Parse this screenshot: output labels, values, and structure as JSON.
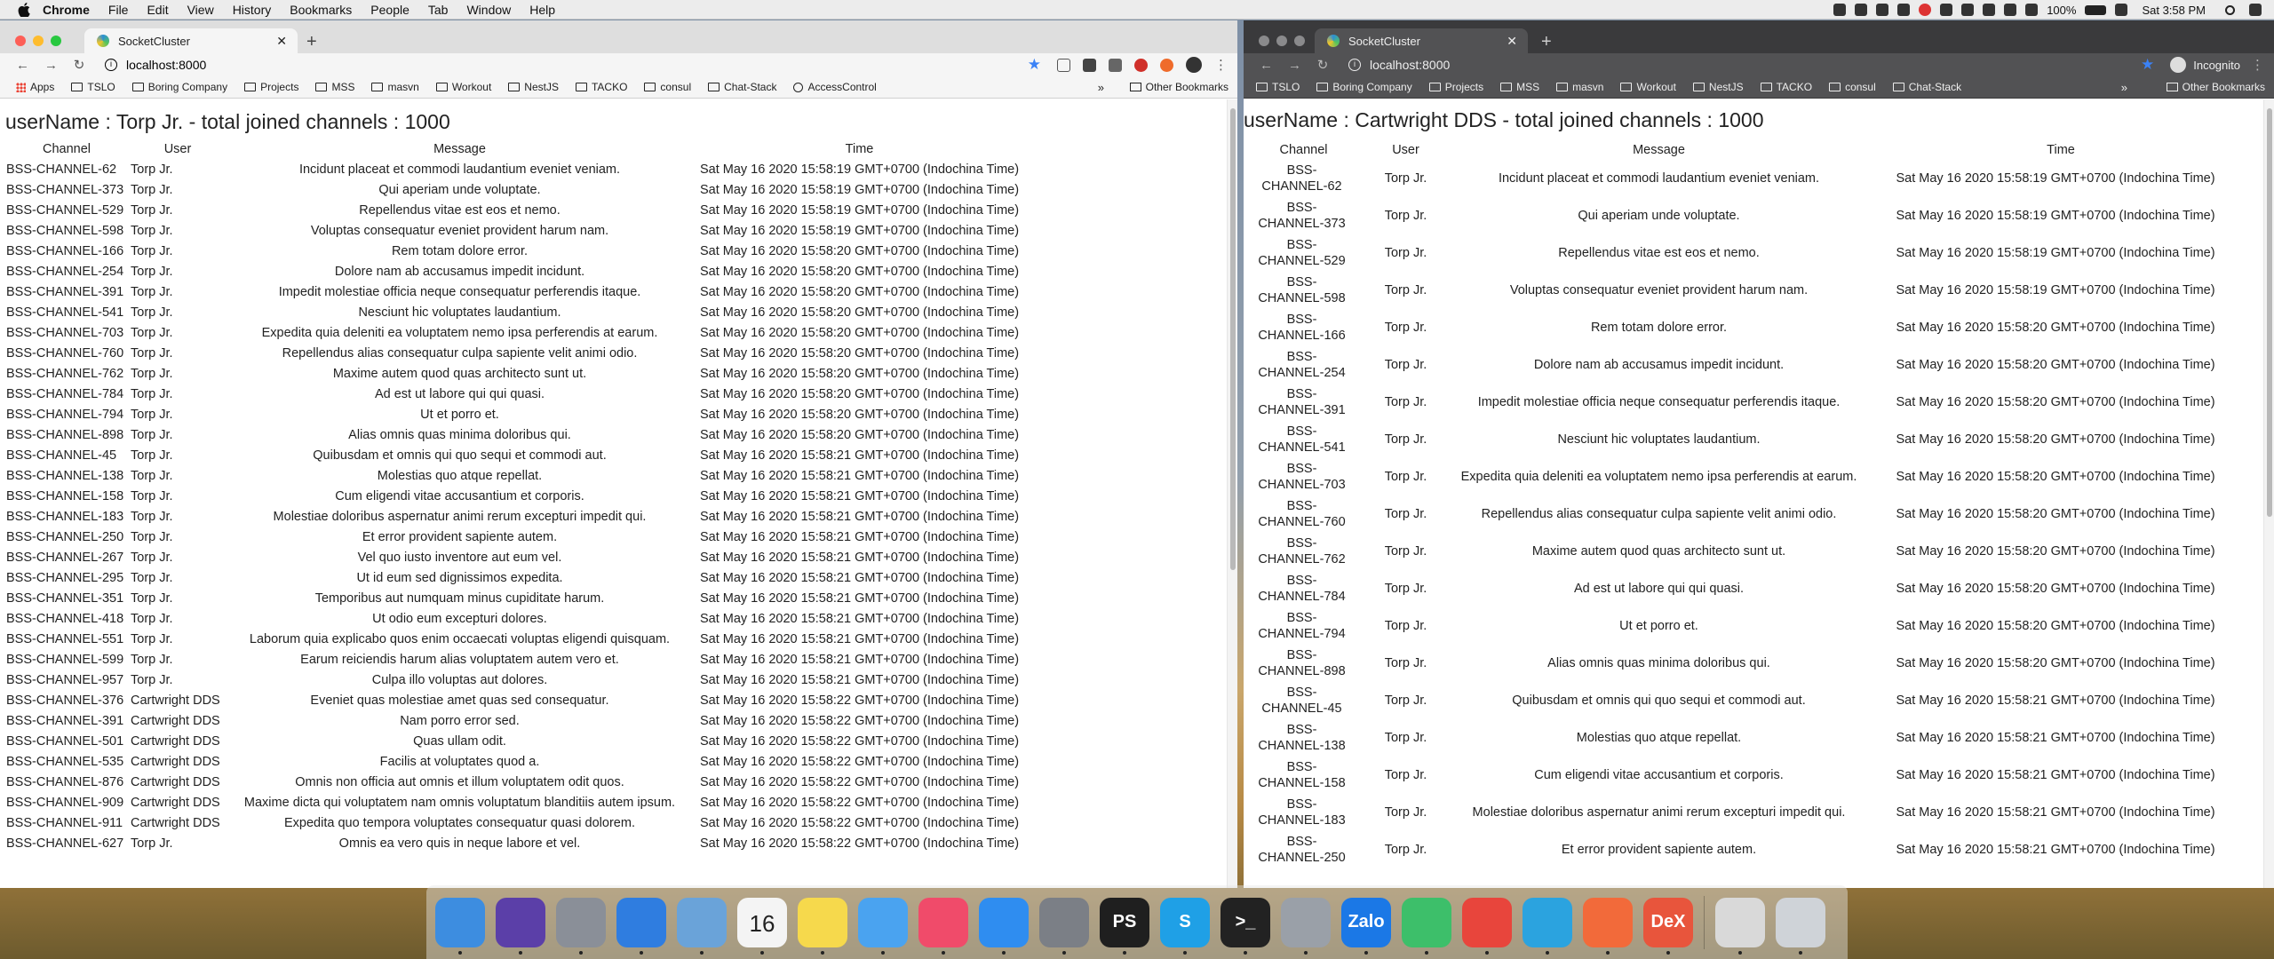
{
  "menubar": {
    "items": [
      "Chrome",
      "File",
      "Edit",
      "View",
      "History",
      "Bookmarks",
      "People",
      "Tab",
      "Window",
      "Help"
    ],
    "battery": "100%",
    "clock": "Sat 3:58 PM"
  },
  "left_window": {
    "tab_title": "SocketCluster",
    "url": "localhost:8000",
    "bookmarks": [
      "Apps",
      "TSLO",
      "Boring Company",
      "Projects",
      "MSS",
      "masvn",
      "Workout",
      "NestJS",
      "TACKO",
      "consul",
      "Chat-Stack",
      "AccessControl"
    ],
    "bookmarks_more": "»",
    "other_bookmarks": "Other Bookmarks",
    "heading": "userName : Torp Jr. - total joined channels : 1000",
    "columns": [
      "Channel",
      "User",
      "Message",
      "Time"
    ],
    "rows": [
      {
        "channel": "BSS-CHANNEL-62",
        "user": "Torp Jr.",
        "message": "Incidunt placeat et commodi laudantium eveniet veniam.",
        "time": "Sat May 16 2020 15:58:19 GMT+0700 (Indochina Time)"
      },
      {
        "channel": "BSS-CHANNEL-373",
        "user": "Torp Jr.",
        "message": "Qui aperiam unde voluptate.",
        "time": "Sat May 16 2020 15:58:19 GMT+0700 (Indochina Time)"
      },
      {
        "channel": "BSS-CHANNEL-529",
        "user": "Torp Jr.",
        "message": "Repellendus vitae est eos et nemo.",
        "time": "Sat May 16 2020 15:58:19 GMT+0700 (Indochina Time)"
      },
      {
        "channel": "BSS-CHANNEL-598",
        "user": "Torp Jr.",
        "message": "Voluptas consequatur eveniet provident harum nam.",
        "time": "Sat May 16 2020 15:58:19 GMT+0700 (Indochina Time)"
      },
      {
        "channel": "BSS-CHANNEL-166",
        "user": "Torp Jr.",
        "message": "Rem totam dolore error.",
        "time": "Sat May 16 2020 15:58:20 GMT+0700 (Indochina Time)"
      },
      {
        "channel": "BSS-CHANNEL-254",
        "user": "Torp Jr.",
        "message": "Dolore nam ab accusamus impedit incidunt.",
        "time": "Sat May 16 2020 15:58:20 GMT+0700 (Indochina Time)"
      },
      {
        "channel": "BSS-CHANNEL-391",
        "user": "Torp Jr.",
        "message": "Impedit molestiae officia neque consequatur perferendis itaque.",
        "time": "Sat May 16 2020 15:58:20 GMT+0700 (Indochina Time)"
      },
      {
        "channel": "BSS-CHANNEL-541",
        "user": "Torp Jr.",
        "message": "Nesciunt hic voluptates laudantium.",
        "time": "Sat May 16 2020 15:58:20 GMT+0700 (Indochina Time)"
      },
      {
        "channel": "BSS-CHANNEL-703",
        "user": "Torp Jr.",
        "message": "Expedita quia deleniti ea voluptatem nemo ipsa perferendis at earum.",
        "time": "Sat May 16 2020 15:58:20 GMT+0700 (Indochina Time)"
      },
      {
        "channel": "BSS-CHANNEL-760",
        "user": "Torp Jr.",
        "message": "Repellendus alias consequatur culpa sapiente velit animi odio.",
        "time": "Sat May 16 2020 15:58:20 GMT+0700 (Indochina Time)"
      },
      {
        "channel": "BSS-CHANNEL-762",
        "user": "Torp Jr.",
        "message": "Maxime autem quod quas architecto sunt ut.",
        "time": "Sat May 16 2020 15:58:20 GMT+0700 (Indochina Time)"
      },
      {
        "channel": "BSS-CHANNEL-784",
        "user": "Torp Jr.",
        "message": "Ad est ut labore qui qui quasi.",
        "time": "Sat May 16 2020 15:58:20 GMT+0700 (Indochina Time)"
      },
      {
        "channel": "BSS-CHANNEL-794",
        "user": "Torp Jr.",
        "message": "Ut et porro et.",
        "time": "Sat May 16 2020 15:58:20 GMT+0700 (Indochina Time)"
      },
      {
        "channel": "BSS-CHANNEL-898",
        "user": "Torp Jr.",
        "message": "Alias omnis quas minima doloribus qui.",
        "time": "Sat May 16 2020 15:58:20 GMT+0700 (Indochina Time)"
      },
      {
        "channel": "BSS-CHANNEL-45",
        "user": "Torp Jr.",
        "message": "Quibusdam et omnis qui quo sequi et commodi aut.",
        "time": "Sat May 16 2020 15:58:21 GMT+0700 (Indochina Time)"
      },
      {
        "channel": "BSS-CHANNEL-138",
        "user": "Torp Jr.",
        "message": "Molestias quo atque repellat.",
        "time": "Sat May 16 2020 15:58:21 GMT+0700 (Indochina Time)"
      },
      {
        "channel": "BSS-CHANNEL-158",
        "user": "Torp Jr.",
        "message": "Cum eligendi vitae accusantium et corporis.",
        "time": "Sat May 16 2020 15:58:21 GMT+0700 (Indochina Time)"
      },
      {
        "channel": "BSS-CHANNEL-183",
        "user": "Torp Jr.",
        "message": "Molestiae doloribus aspernatur animi rerum excepturi impedit qui.",
        "time": "Sat May 16 2020 15:58:21 GMT+0700 (Indochina Time)"
      },
      {
        "channel": "BSS-CHANNEL-250",
        "user": "Torp Jr.",
        "message": "Et error provident sapiente autem.",
        "time": "Sat May 16 2020 15:58:21 GMT+0700 (Indochina Time)"
      },
      {
        "channel": "BSS-CHANNEL-267",
        "user": "Torp Jr.",
        "message": "Vel quo iusto inventore aut eum vel.",
        "time": "Sat May 16 2020 15:58:21 GMT+0700 (Indochina Time)"
      },
      {
        "channel": "BSS-CHANNEL-295",
        "user": "Torp Jr.",
        "message": "Ut id eum sed dignissimos expedita.",
        "time": "Sat May 16 2020 15:58:21 GMT+0700 (Indochina Time)"
      },
      {
        "channel": "BSS-CHANNEL-351",
        "user": "Torp Jr.",
        "message": "Temporibus aut numquam minus cupiditate harum.",
        "time": "Sat May 16 2020 15:58:21 GMT+0700 (Indochina Time)"
      },
      {
        "channel": "BSS-CHANNEL-418",
        "user": "Torp Jr.",
        "message": "Ut odio eum excepturi dolores.",
        "time": "Sat May 16 2020 15:58:21 GMT+0700 (Indochina Time)"
      },
      {
        "channel": "BSS-CHANNEL-551",
        "user": "Torp Jr.",
        "message": "Laborum quia explicabo quos enim occaecati voluptas eligendi quisquam.",
        "time": "Sat May 16 2020 15:58:21 GMT+0700 (Indochina Time)"
      },
      {
        "channel": "BSS-CHANNEL-599",
        "user": "Torp Jr.",
        "message": "Earum reiciendis harum alias voluptatem autem vero et.",
        "time": "Sat May 16 2020 15:58:21 GMT+0700 (Indochina Time)"
      },
      {
        "channel": "BSS-CHANNEL-957",
        "user": "Torp Jr.",
        "message": "Culpa illo voluptas aut dolores.",
        "time": "Sat May 16 2020 15:58:21 GMT+0700 (Indochina Time)"
      },
      {
        "channel": "BSS-CHANNEL-376",
        "user": "Cartwright DDS",
        "message": "Eveniet quas molestiae amet quas sed consequatur.",
        "time": "Sat May 16 2020 15:58:22 GMT+0700 (Indochina Time)"
      },
      {
        "channel": "BSS-CHANNEL-391",
        "user": "Cartwright DDS",
        "message": "Nam porro error sed.",
        "time": "Sat May 16 2020 15:58:22 GMT+0700 (Indochina Time)"
      },
      {
        "channel": "BSS-CHANNEL-501",
        "user": "Cartwright DDS",
        "message": "Quas ullam odit.",
        "time": "Sat May 16 2020 15:58:22 GMT+0700 (Indochina Time)"
      },
      {
        "channel": "BSS-CHANNEL-535",
        "user": "Cartwright DDS",
        "message": "Facilis at voluptates quod a.",
        "time": "Sat May 16 2020 15:58:22 GMT+0700 (Indochina Time)"
      },
      {
        "channel": "BSS-CHANNEL-876",
        "user": "Cartwright DDS",
        "message": "Omnis non officia aut omnis et illum voluptatem odit quos.",
        "time": "Sat May 16 2020 15:58:22 GMT+0700 (Indochina Time)"
      },
      {
        "channel": "BSS-CHANNEL-909",
        "user": "Cartwright DDS",
        "message": "Maxime dicta qui voluptatem nam omnis voluptatum blanditiis autem ipsum.",
        "time": "Sat May 16 2020 15:58:22 GMT+0700 (Indochina Time)"
      },
      {
        "channel": "BSS-CHANNEL-911",
        "user": "Cartwright DDS",
        "message": "Expedita quo tempora voluptates consequatur quasi dolorem.",
        "time": "Sat May 16 2020 15:58:22 GMT+0700 (Indochina Time)"
      },
      {
        "channel": "BSS-CHANNEL-627",
        "user": "Torp Jr.",
        "message": "Omnis ea vero quis in neque labore et vel.",
        "time": "Sat May 16 2020 15:58:22 GMT+0700 (Indochina Time)"
      }
    ]
  },
  "right_window": {
    "tab_title": "SocketCluster",
    "url": "localhost:8000",
    "incognito_label": "Incognito",
    "bookmarks": [
      "TSLO",
      "Boring Company",
      "Projects",
      "MSS",
      "masvn",
      "Workout",
      "NestJS",
      "TACKO",
      "consul",
      "Chat-Stack"
    ],
    "bookmarks_more": "»",
    "other_bookmarks": "Other Bookmarks",
    "heading": "userName : Cartwright DDS - total joined channels : 1000",
    "columns": [
      "Channel",
      "User",
      "Message",
      "Time"
    ],
    "rows": [
      {
        "channel": "BSS-CHANNEL-62",
        "user": "Torp Jr.",
        "message": "Incidunt placeat et commodi laudantium eveniet veniam.",
        "time": "Sat May 16 2020 15:58:19 GMT+0700 (Indochina Time)"
      },
      {
        "channel": "BSS-CHANNEL-373",
        "user": "Torp Jr.",
        "message": "Qui aperiam unde voluptate.",
        "time": "Sat May 16 2020 15:58:19 GMT+0700 (Indochina Time)"
      },
      {
        "channel": "BSS-CHANNEL-529",
        "user": "Torp Jr.",
        "message": "Repellendus vitae est eos et nemo.",
        "time": "Sat May 16 2020 15:58:19 GMT+0700 (Indochina Time)"
      },
      {
        "channel": "BSS-CHANNEL-598",
        "user": "Torp Jr.",
        "message": "Voluptas consequatur eveniet provident harum nam.",
        "time": "Sat May 16 2020 15:58:19 GMT+0700 (Indochina Time)"
      },
      {
        "channel": "BSS-CHANNEL-166",
        "user": "Torp Jr.",
        "message": "Rem totam dolore error.",
        "time": "Sat May 16 2020 15:58:20 GMT+0700 (Indochina Time)"
      },
      {
        "channel": "BSS-CHANNEL-254",
        "user": "Torp Jr.",
        "message": "Dolore nam ab accusamus impedit incidunt.",
        "time": "Sat May 16 2020 15:58:20 GMT+0700 (Indochina Time)"
      },
      {
        "channel": "BSS-CHANNEL-391",
        "user": "Torp Jr.",
        "message": "Impedit molestiae officia neque consequatur perferendis itaque.",
        "time": "Sat May 16 2020 15:58:20 GMT+0700 (Indochina Time)"
      },
      {
        "channel": "BSS-CHANNEL-541",
        "user": "Torp Jr.",
        "message": "Nesciunt hic voluptates laudantium.",
        "time": "Sat May 16 2020 15:58:20 GMT+0700 (Indochina Time)"
      },
      {
        "channel": "BSS-CHANNEL-703",
        "user": "Torp Jr.",
        "message": "Expedita quia deleniti ea voluptatem nemo ipsa perferendis at earum.",
        "time": "Sat May 16 2020 15:58:20 GMT+0700 (Indochina Time)"
      },
      {
        "channel": "BSS-CHANNEL-760",
        "user": "Torp Jr.",
        "message": "Repellendus alias consequatur culpa sapiente velit animi odio.",
        "time": "Sat May 16 2020 15:58:20 GMT+0700 (Indochina Time)"
      },
      {
        "channel": "BSS-CHANNEL-762",
        "user": "Torp Jr.",
        "message": "Maxime autem quod quas architecto sunt ut.",
        "time": "Sat May 16 2020 15:58:20 GMT+0700 (Indochina Time)"
      },
      {
        "channel": "BSS-CHANNEL-784",
        "user": "Torp Jr.",
        "message": "Ad est ut labore qui qui quasi.",
        "time": "Sat May 16 2020 15:58:20 GMT+0700 (Indochina Time)"
      },
      {
        "channel": "BSS-CHANNEL-794",
        "user": "Torp Jr.",
        "message": "Ut et porro et.",
        "time": "Sat May 16 2020 15:58:20 GMT+0700 (Indochina Time)"
      },
      {
        "channel": "BSS-CHANNEL-898",
        "user": "Torp Jr.",
        "message": "Alias omnis quas minima doloribus qui.",
        "time": "Sat May 16 2020 15:58:20 GMT+0700 (Indochina Time)"
      },
      {
        "channel": "BSS-CHANNEL-45",
        "user": "Torp Jr.",
        "message": "Quibusdam et omnis qui quo sequi et commodi aut.",
        "time": "Sat May 16 2020 15:58:21 GMT+0700 (Indochina Time)"
      },
      {
        "channel": "BSS-CHANNEL-138",
        "user": "Torp Jr.",
        "message": "Molestias quo atque repellat.",
        "time": "Sat May 16 2020 15:58:21 GMT+0700 (Indochina Time)"
      },
      {
        "channel": "BSS-CHANNEL-158",
        "user": "Torp Jr.",
        "message": "Cum eligendi vitae accusantium et corporis.",
        "time": "Sat May 16 2020 15:58:21 GMT+0700 (Indochina Time)"
      },
      {
        "channel": "BSS-CHANNEL-183",
        "user": "Torp Jr.",
        "message": "Molestiae doloribus aspernatur animi rerum excepturi impedit qui.",
        "time": "Sat May 16 2020 15:58:21 GMT+0700 (Indochina Time)"
      },
      {
        "channel": "BSS-CHANNEL-250",
        "user": "Torp Jr.",
        "message": "Et error provident sapiente autem.",
        "time": "Sat May 16 2020 15:58:21 GMT+0700 (Indochina Time)"
      }
    ]
  },
  "dock": {
    "apps": [
      {
        "name": "finder-icon",
        "color": "#3d8de0",
        "label": ""
      },
      {
        "name": "siri-icon",
        "color": "#5b3fa8",
        "label": ""
      },
      {
        "name": "launchpad-icon",
        "color": "#8a8f98",
        "label": ""
      },
      {
        "name": "safari-icon",
        "color": "#2f7de0",
        "label": ""
      },
      {
        "name": "mail-icon",
        "color": "#6aa3d9",
        "label": ""
      },
      {
        "name": "calendar-icon",
        "color": "#f4f4f4",
        "label": "16"
      },
      {
        "name": "notes-icon",
        "color": "#f6d94c",
        "label": ""
      },
      {
        "name": "messages-icon",
        "color": "#4aa3f0",
        "label": ""
      },
      {
        "name": "music-icon",
        "color": "#f04b6a",
        "label": ""
      },
      {
        "name": "app-store-icon",
        "color": "#2f8df0",
        "label": ""
      },
      {
        "name": "system-preferences-icon",
        "color": "#7b7f86",
        "label": ""
      },
      {
        "name": "phpstorm-icon",
        "color": "#1f1f1f",
        "label": "PS"
      },
      {
        "name": "skype-icon",
        "color": "#1fa0e6",
        "label": "S"
      },
      {
        "name": "terminal-icon",
        "color": "#222222",
        "label": ">_"
      },
      {
        "name": "preferences-icon",
        "color": "#9aa0a8",
        "label": ""
      },
      {
        "name": "zalo-icon",
        "color": "#1b78e6",
        "label": "Zalo"
      },
      {
        "name": "creative-icon",
        "color": "#3dbf6a",
        "label": ""
      },
      {
        "name": "chrome-icon",
        "color": "#e8453c",
        "label": ""
      },
      {
        "name": "telegram-icon",
        "color": "#2ba3df",
        "label": ""
      },
      {
        "name": "postman-icon",
        "color": "#f26a3a",
        "label": ""
      },
      {
        "name": "dex-icon",
        "color": "#e8553c",
        "label": "DeX"
      },
      {
        "name": "archive-icon",
        "color": "#d9d9d9",
        "label": ""
      },
      {
        "name": "trash-icon",
        "color": "#cfd3d8",
        "label": ""
      }
    ]
  }
}
